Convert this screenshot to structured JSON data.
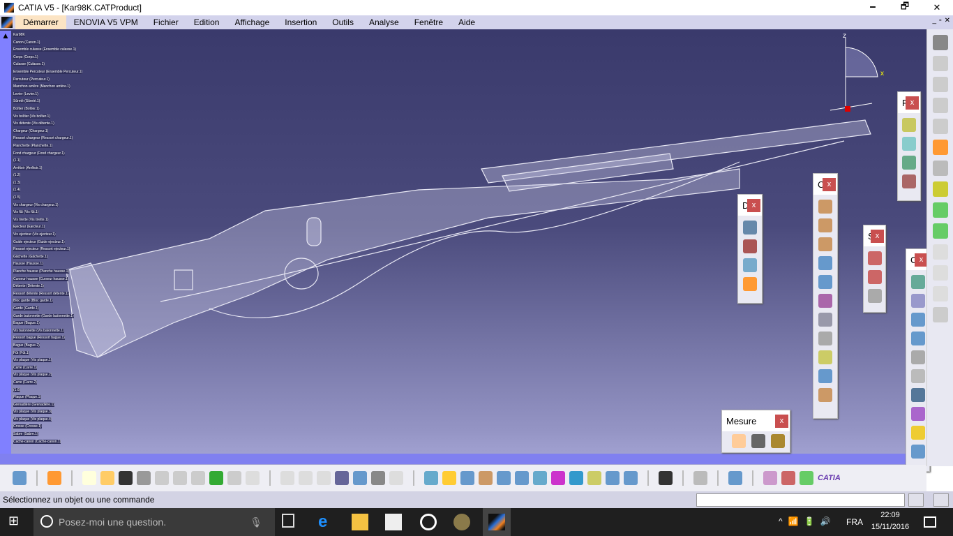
{
  "window": {
    "title": "CATIA V5 - [Kar98K.CATProduct]",
    "minimize": "🗕",
    "maximize": "🗗",
    "close": "✕"
  },
  "menu": {
    "items": [
      "Démarrer",
      "ENOVIA V5 VPM",
      "Fichier",
      "Edition",
      "Affichage",
      "Insertion",
      "Outils",
      "Analyse",
      "Fenêtre",
      "Aide"
    ]
  },
  "tree": {
    "root": "Kar98K",
    "items": [
      "Canon (Canon.1)",
      "Ensemble culasse (Ensemble culasse.1)",
      "Corps (Corps.1)",
      "Culasse (Culasse.1)",
      "Ensemble Percuteur (Ensemble Percuteur.1)",
      "Percuteur (Percuteur.1)",
      "Manchon arrière (Manchon arrière.1)",
      "Levier (Levier.1)",
      "Sûreté (Sûreté.1)",
      "Boîtier (Boîtier.1)",
      "Vis boîtier (Vis boîtier.1)",
      "Vis détente (Vis détente.1)",
      "Chargeur (Chargeur.1)",
      "Ressort chargeur (Ressort chargeur.1)",
      "Planchette (Planchette.1)",
      "Fond chargeur (Fond chargeur.1)",
      "(1.1)",
      "Arrêtoir (Arrêtoir.1)",
      "(1.2)",
      "(1.3)",
      "(1.4)",
      "(1.5)",
      "Vis chargeur (Vis chargeur.1)",
      "Vis fût (Vis fût.1)",
      "Vis tirette (Vis tirette.1)",
      "Ejecteur (Ejecteur.1)",
      "Vis ejecteur (Vis ejecteur.1)",
      "Guide ejecteur (Guide ejecteur.1)",
      "Ressort ejecteur (Ressort ejecteur.1)",
      "Gâchette (Gâchette.1)",
      "Hausse (Hausse.1)",
      "Planche hausse (Planche hausse.1)",
      "Curseur hausse (Curseur hausse.1)",
      "Détente (Détente.1)",
      "Ressort détente (Ressort détente.1)",
      "Bloc garde (Bloc garde.1)",
      "Garde (Garde.1)",
      "Garde baïonnette (Garde baïonnette.1)",
      "Bague (Bague.1)",
      "Vis baïonnette (Vis baïonnette.1)",
      "Ressort bague (Ressort bague.1)",
      "Bague (Bague.2)",
      "Fût (Fût.1)",
      "Vis plaque (Vis plaque.1)",
      "Carre (Carre.1)",
      "Vis plaque (Vis plaque.2)",
      "Carre (Carre.2)",
      "(1.6)",
      "Plaque (Plaque.1)",
      "Grenadière (Grenadière.1)",
      "Vis plaque (Vis plaque.3)",
      "Vis plaque (Vis plaque.4)",
      "Crosse (Crosse.1)",
      "Sabre (Sabre.1)",
      "Cache-canon (Cache-canon.1)"
    ]
  },
  "compass": {
    "x_label": "x",
    "z_label": "z"
  },
  "toolbars": {
    "f": "F",
    "d": "D",
    "c1": "C",
    "s": "S",
    "c2": "C",
    "mesure": "Mesure",
    "close": "x"
  },
  "status": {
    "message": "Sélectionnez un objet ou une commande",
    "command_input": ""
  },
  "taskbar": {
    "search_placeholder": "Posez-moi une question.",
    "lang": "FRA",
    "time": "22:09",
    "date": "15/11/2016"
  },
  "colors": {
    "menu": "#d3d3ec",
    "viewport_top": "#3a3a6c",
    "viewport_bottom": "#a6a6d6",
    "accent_scroll": "#8080ff",
    "close": "#c94f4f"
  }
}
